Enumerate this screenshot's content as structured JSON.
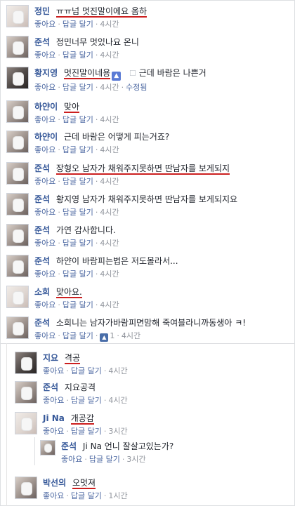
{
  "comments": [
    {
      "name": "정민",
      "text": "ㅠㅠ넘 멋진말이에요 옴하",
      "actions": {
        "like": "좋아요",
        "reply": "답글 달기",
        "time": "4시간"
      }
    },
    {
      "name": "준석",
      "text": "정민너무 멋있나요 온니",
      "actions": {
        "like": "좋아요",
        "reply": "답글 달기",
        "time": "4시간"
      }
    },
    {
      "name": "황지영",
      "text": "멋진말이네용",
      "text2": "근데 바람은 나쁜거",
      "actions": {
        "like": "좋아요",
        "reply": "답글 달기",
        "time": "4시간",
        "edited": "수정됨"
      }
    },
    {
      "name": "하얀이",
      "text": "맞아",
      "actions": {
        "like": "좋아요",
        "reply": "답글 달기",
        "time": "4시간"
      }
    },
    {
      "name": "하얀이",
      "text": "근데 바람은 어떻게 피는거죠?",
      "actions": {
        "like": "좋아요",
        "reply": "답글 달기",
        "time": "4시간"
      }
    },
    {
      "name": "준석",
      "text": "장형오 남자가 채워주지못하면 딴남자를 보게되지",
      "actions": {
        "like": "좋아요",
        "reply": "답글 달기",
        "time": "4시간"
      }
    },
    {
      "name": "준석",
      "text": "황지영 남자가 채워주지못하면 딴남자를 보게되지요",
      "actions": {
        "like": "좋아요",
        "reply": "답글 달기",
        "time": "4시간"
      }
    },
    {
      "name": "준석",
      "text": "가연 감사합니다.",
      "actions": {
        "like": "좋아요",
        "reply": "답글 달기",
        "time": "4시간"
      }
    },
    {
      "name": "준석",
      "text": "하얀이 바람피는법은 저도몰라서...",
      "actions": {
        "like": "좋아요",
        "reply": "답글 달기",
        "time": "4시간"
      }
    },
    {
      "name": "소희",
      "text": "맞아요.",
      "actions": {
        "like": "좋아요",
        "reply": "답글 달기",
        "time": "4시간"
      }
    },
    {
      "name": "준석",
      "text": "소희니는 남자가바람피면맘해 죽여블라니까동생아 ㅋ!",
      "actions": {
        "like": "좋아요",
        "reply": "답글 달기",
        "likes": "1",
        "time": "4시간"
      }
    }
  ],
  "replies": [
    {
      "name": "지요",
      "text": "격공",
      "actions": {
        "like": "좋아요",
        "reply": "답글 달기",
        "time": "4시간"
      }
    },
    {
      "name": "준석",
      "text": "지요공격",
      "actions": {
        "like": "좋아요",
        "reply": "답글 달기",
        "time": "4시간"
      }
    },
    {
      "name": "Ji Na",
      "text": "개공감",
      "actions": {
        "like": "좋아요",
        "reply": "답글 달기",
        "time": "3시간"
      }
    },
    {
      "name": "준석",
      "text": "Ji Na 언니 잘살고있는가?",
      "actions": {
        "like": "좋아요",
        "reply": "답글 달기",
        "time": "3시간"
      }
    },
    {
      "name": "박선의",
      "text": "오멋져",
      "actions": {
        "like": "좋아요",
        "reply": "답글 달기",
        "time": "1시간"
      }
    }
  ],
  "icons": {
    "like_thumb": "thumbs-up-icon",
    "hover": "hover-edit-icon"
  },
  "colors": {
    "name": "#365899",
    "meta": "#90949c",
    "link": "#4b67a1",
    "underline": "#cc1f1f"
  }
}
